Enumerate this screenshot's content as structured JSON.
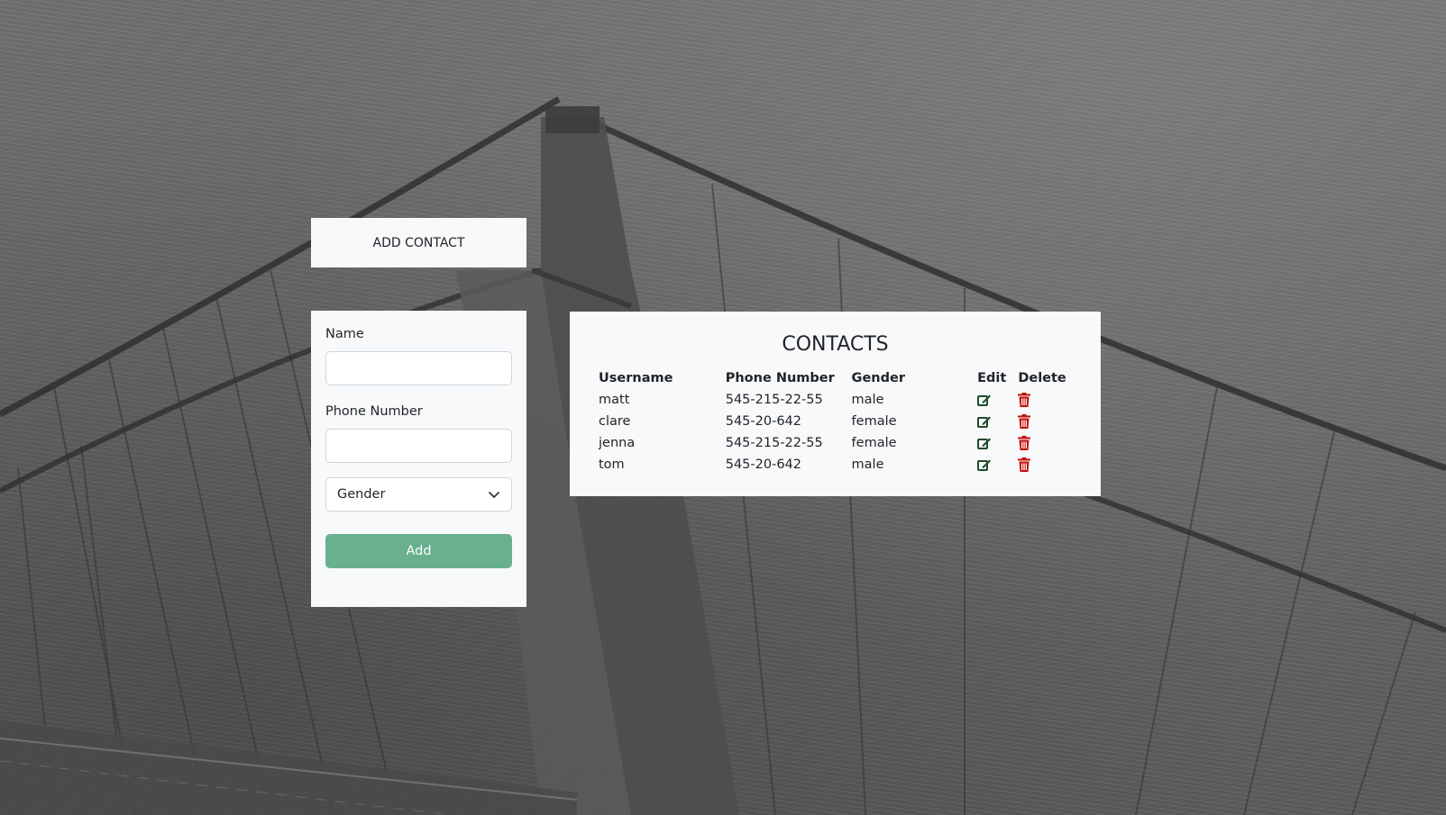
{
  "add_contact": {
    "header": "ADD CONTACT",
    "name_label": "Name",
    "name_value": "",
    "phone_label": "Phone Number",
    "phone_value": "",
    "gender_select": "Gender",
    "add_button": "Add"
  },
  "contacts": {
    "title": "CONTACTS",
    "columns": [
      "Username",
      "Phone Number",
      "Gender",
      "Edit",
      "Delete"
    ],
    "rows": [
      {
        "username": "matt",
        "phone": "545-215-22-55",
        "gender": "male"
      },
      {
        "username": "clare",
        "phone": "545-20-642",
        "gender": "female"
      },
      {
        "username": "jenna",
        "phone": "545-215-22-55",
        "gender": "female"
      },
      {
        "username": "tom",
        "phone": "545-20-642",
        "gender": "male"
      }
    ],
    "edit_icon": "edit-icon",
    "delete_icon": "trash-icon"
  },
  "colors": {
    "card_background": "#f8f9fa",
    "add_button": "#68b08e",
    "edit_icon": "#1e4d2b",
    "delete_icon": "#c0120b"
  }
}
